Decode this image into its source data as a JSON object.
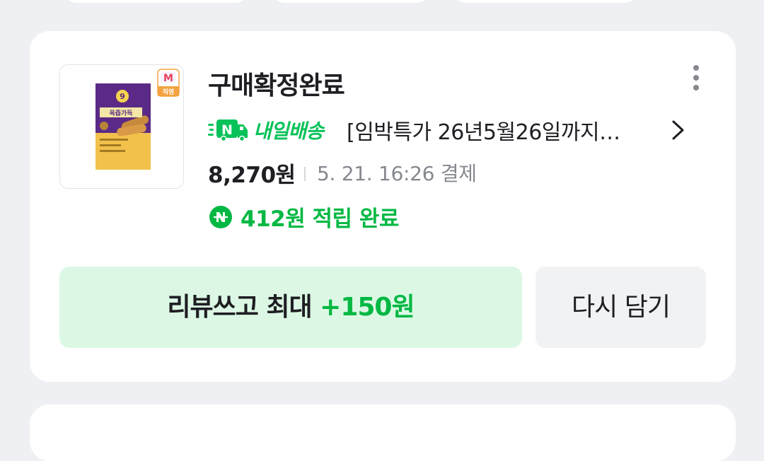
{
  "order": {
    "status": "구매확정완료",
    "product_thumbnail_alt": "product-package",
    "store_badge_label": "직영",
    "delivery_label": "내일배송",
    "product_name": "[임박특가 26년5월26일까지…",
    "price": "8,270원",
    "paid_at": "5. 21. 16:26 결제",
    "points_label": "412원 적립 완료",
    "icons": {
      "more": "more-vertical-icon",
      "chevron": "chevron-right-icon",
      "delivery": "delivery-truck-icon",
      "npay": "npay-point-icon"
    }
  },
  "actions": {
    "review_label": "리뷰쓰고 최대",
    "review_reward": "+150원",
    "rebuy_label": "다시 담기"
  },
  "colors": {
    "naver_green": "#00b843",
    "review_bg": "#dcf8e4",
    "rebuy_bg": "#f1f2f4",
    "page_bg": "#eff0f3"
  }
}
